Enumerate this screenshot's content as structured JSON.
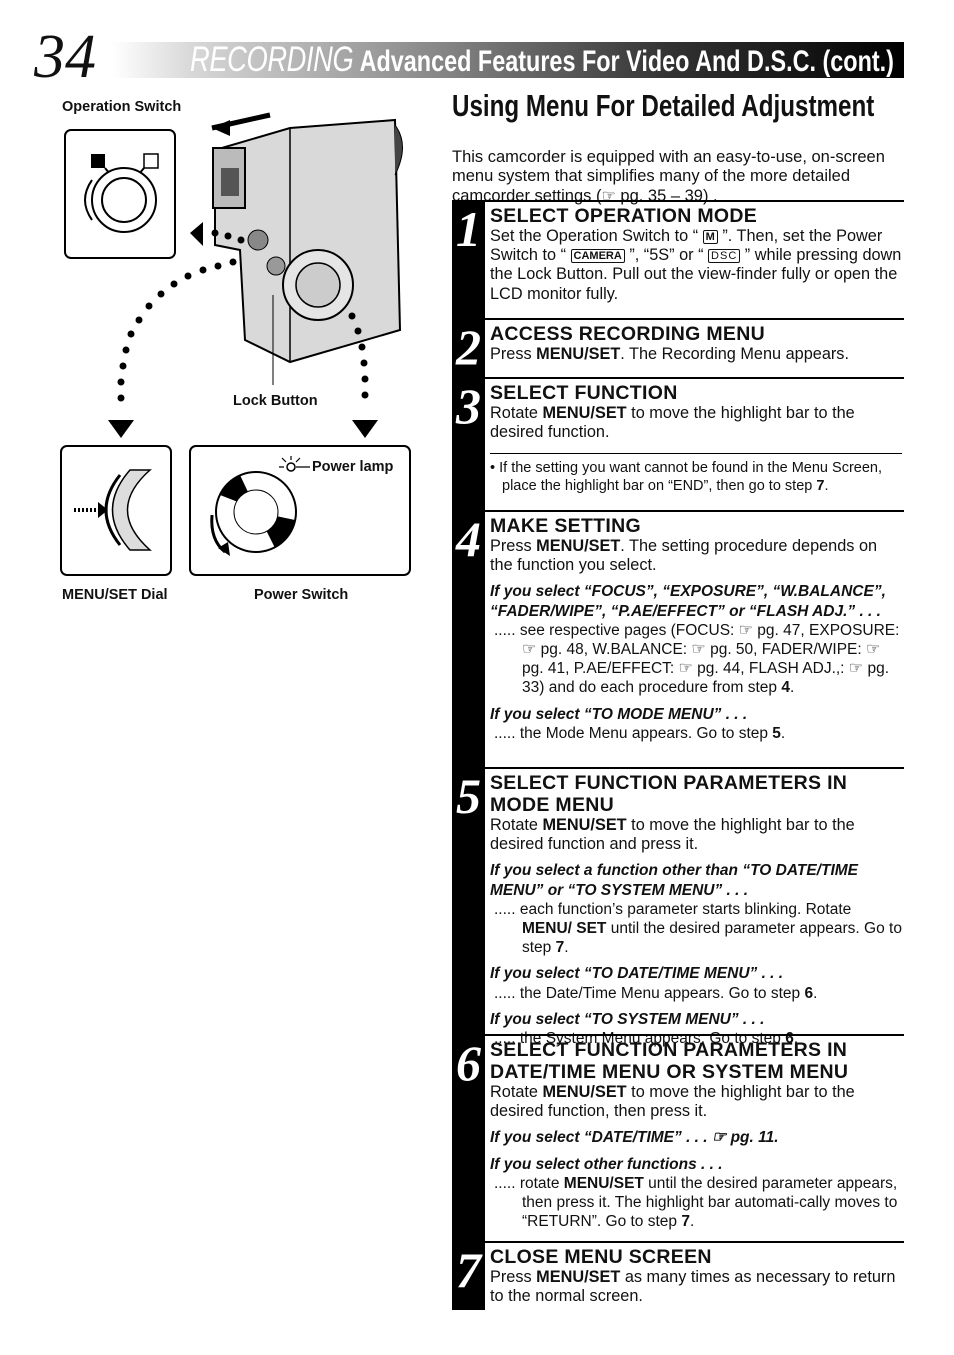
{
  "header": {
    "page_number": "34",
    "section": "RECORDING",
    "title": "Advanced Features For Video And D.S.C. (cont.)"
  },
  "illustration": {
    "labels": {
      "operation_switch": "Operation Switch",
      "lock_button": "Lock Button",
      "power_lamp": "Power lamp",
      "menu_set_dial": "MENU/SET Dial",
      "power_switch": "Power Switch"
    }
  },
  "main": {
    "title": "Using Menu For Detailed Adjustment",
    "intro": [
      {
        "t": "This camcorder is equipped with an easy-to-use, on-screen menu system that simplifies many of the more detailed camcorder settings ("
      },
      {
        "icon": "hand-pointer-icon",
        "t": "☞"
      },
      {
        "t": " pg. 35 – 39) ."
      }
    ]
  },
  "steps": [
    {
      "number": "1",
      "heading": "SELECT OPERATION MODE",
      "blocks": [
        {
          "type": "body",
          "parts": [
            {
              "t": "Set the Operation Switch to “ "
            },
            {
              "icon": "manual-mode-icon",
              "t": "M"
            },
            {
              "t": " ”. Then, set the Power Switch to “ "
            },
            {
              "icon": "camera-mode-icon",
              "t": "CAMERA"
            },
            {
              "t": " ”, “5S” or “ "
            },
            {
              "icon": "dsc-mode-icon",
              "t": "DSC"
            },
            {
              "t": " ” while pressing down the Lock Button. Pull out the view-finder fully or open the LCD monitor fully."
            }
          ]
        }
      ]
    },
    {
      "number": "2",
      "heading": "ACCESS RECORDING MENU",
      "blocks": [
        {
          "type": "body",
          "parts": [
            {
              "t": "Press "
            },
            {
              "t": "MENU/SET",
              "b": true
            },
            {
              "t": ". The Recording Menu appears."
            }
          ]
        }
      ]
    },
    {
      "number": "3",
      "heading": "SELECT FUNCTION",
      "blocks": [
        {
          "type": "body",
          "parts": [
            {
              "t": "Rotate "
            },
            {
              "t": "MENU/SET",
              "b": true
            },
            {
              "t": " to move the highlight bar to the desired function."
            }
          ]
        },
        {
          "type": "note",
          "parts": [
            {
              "t": "• If the setting you want cannot be found in the Menu Screen, place the highlight bar on “END”, then go to step "
            },
            {
              "t": "7",
              "b": true
            },
            {
              "t": "."
            }
          ]
        }
      ]
    },
    {
      "number": "4",
      "heading": "MAKE SETTING",
      "blocks": [
        {
          "type": "body",
          "parts": [
            {
              "t": "Press "
            },
            {
              "t": "MENU/SET",
              "b": true
            },
            {
              "t": ". The setting procedure depends on the function you select."
            }
          ]
        },
        {
          "type": "italic",
          "parts": [
            {
              "t": "If you select “FOCUS”, “EXPOSURE”, “W.BALANCE”, “FADER/WIPE”, “P.AE/EFFECT” or “FLASH ADJ.” . . ."
            }
          ]
        },
        {
          "type": "sub",
          "parts": [
            {
              "t": "..... see respective pages (FOCUS: "
            },
            {
              "icon": "hand-pointer-icon",
              "t": "☞"
            },
            {
              "t": " pg. 47, EXPOSURE: "
            },
            {
              "icon": "hand-pointer-icon",
              "t": "☞"
            },
            {
              "t": " pg. 48, W.BALANCE: "
            },
            {
              "icon": "hand-pointer-icon",
              "t": "☞"
            },
            {
              "t": " pg. 50, FADER/WIPE: "
            },
            {
              "icon": "hand-pointer-icon",
              "t": "☞"
            },
            {
              "t": " pg. 41, P.AE/EFFECT: "
            },
            {
              "icon": "hand-pointer-icon",
              "t": "☞"
            },
            {
              "t": " pg. 44, FLASH ADJ.,: "
            },
            {
              "icon": "hand-pointer-icon",
              "t": "☞"
            },
            {
              "t": " pg. 33) and do each procedure from step "
            },
            {
              "t": "4",
              "b": true
            },
            {
              "t": "."
            }
          ]
        },
        {
          "type": "italic",
          "parts": [
            {
              "t": "If you select “TO MODE MENU” . . ."
            }
          ]
        },
        {
          "type": "sub",
          "parts": [
            {
              "t": "..... the Mode Menu appears. Go to step "
            },
            {
              "t": "5",
              "b": true
            },
            {
              "t": "."
            }
          ]
        }
      ]
    },
    {
      "number": "5",
      "heading": "SELECT FUNCTION PARAMETERS IN MODE MENU",
      "blocks": [
        {
          "type": "body",
          "parts": [
            {
              "t": "Rotate "
            },
            {
              "t": "MENU/SET",
              "b": true
            },
            {
              "t": " to move the highlight bar to the desired function and press it."
            }
          ]
        },
        {
          "type": "italic",
          "parts": [
            {
              "t": "If you select a function other than “TO DATE/TIME MENU” or “TO SYSTEM MENU” . . ."
            }
          ]
        },
        {
          "type": "sub",
          "parts": [
            {
              "t": "..... each function’s parameter starts blinking. Rotate "
            },
            {
              "t": "MENU/ SET",
              "b": true
            },
            {
              "t": " until the desired parameter appears. Go to step "
            },
            {
              "t": "7",
              "b": true
            },
            {
              "t": "."
            }
          ]
        },
        {
          "type": "italic",
          "parts": [
            {
              "t": "If you select “TO DATE/TIME MENU” . . ."
            }
          ]
        },
        {
          "type": "sub",
          "parts": [
            {
              "t": "..... the Date/Time Menu appears. Go to step "
            },
            {
              "t": "6",
              "b": true
            },
            {
              "t": "."
            }
          ]
        },
        {
          "type": "italic",
          "parts": [
            {
              "t": "If you select “TO SYSTEM MENU” . . ."
            }
          ]
        },
        {
          "type": "sub",
          "parts": [
            {
              "t": "..... the System Menu appears. Go to step "
            },
            {
              "t": "6",
              "b": true
            },
            {
              "t": "."
            }
          ]
        }
      ]
    },
    {
      "number": "6",
      "heading": "SELECT FUNCTION PARAMETERS IN DATE/TIME MENU OR SYSTEM MENU",
      "blocks": [
        {
          "type": "body",
          "parts": [
            {
              "t": "Rotate "
            },
            {
              "t": "MENU/SET",
              "b": true
            },
            {
              "t": " to move the highlight bar to the desired function, then press it."
            }
          ]
        },
        {
          "type": "italic",
          "parts": [
            {
              "t": "If you select “DATE/TIME” . . . "
            },
            {
              "icon": "hand-pointer-icon",
              "t": "☞"
            },
            {
              "t": " pg. 11."
            }
          ]
        },
        {
          "type": "italic",
          "parts": [
            {
              "t": "If you select other functions . . ."
            }
          ]
        },
        {
          "type": "sub",
          "parts": [
            {
              "t": "..... rotate "
            },
            {
              "t": "MENU/SET",
              "b": true
            },
            {
              "t": " until the desired parameter appears, then press it. The highlight bar automati-cally moves to “RETURN”. Go to step "
            },
            {
              "t": "7",
              "b": true
            },
            {
              "t": "."
            }
          ]
        }
      ]
    },
    {
      "number": "7",
      "heading": "CLOSE MENU SCREEN",
      "blocks": [
        {
          "type": "body",
          "parts": [
            {
              "t": "Press "
            },
            {
              "t": "MENU/SET",
              "b": true
            },
            {
              "t": " as many times as necessary to return to the normal screen."
            }
          ]
        }
      ]
    }
  ]
}
